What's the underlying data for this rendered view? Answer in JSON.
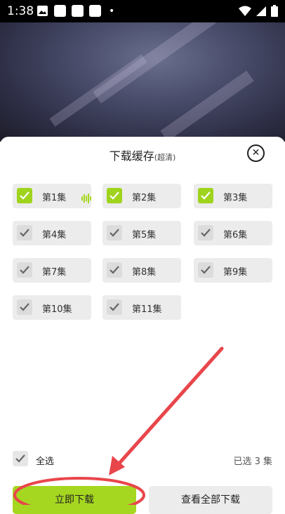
{
  "status_bar": {
    "time": "1:38",
    "dot": "•"
  },
  "sheet": {
    "title": "下载缓存",
    "quality": "(超清)",
    "close_icon": "close-circle-icon"
  },
  "episodes": [
    {
      "label": "第1集",
      "checked": true,
      "playing": true
    },
    {
      "label": "第2集",
      "checked": true
    },
    {
      "label": "第3集",
      "checked": true
    },
    {
      "label": "第4集",
      "checked": false
    },
    {
      "label": "第5集",
      "checked": false
    },
    {
      "label": "第6集",
      "checked": false
    },
    {
      "label": "第7集",
      "checked": false
    },
    {
      "label": "第8集",
      "checked": false
    },
    {
      "label": "第9集",
      "checked": false
    },
    {
      "label": "第10集",
      "checked": false
    },
    {
      "label": "第11集",
      "checked": false
    }
  ],
  "footer": {
    "select_all_label": "全选",
    "selected_count": "已选 3 集",
    "download_button": "立即下载",
    "view_all_button": "查看全部下载"
  },
  "colors": {
    "accent": "#a6d720",
    "annotation": "#e8464b"
  }
}
